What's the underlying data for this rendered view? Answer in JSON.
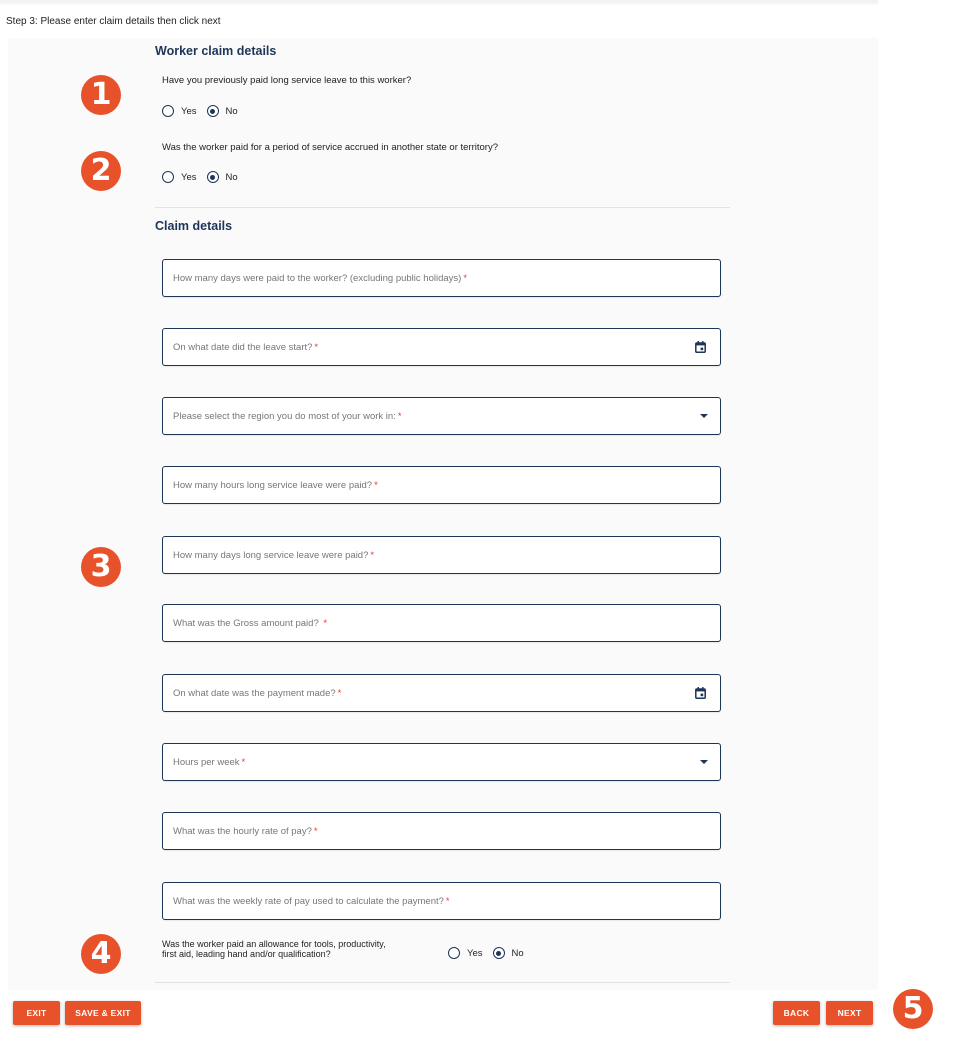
{
  "step_instruction": "Step 3: Please enter claim details then click next",
  "worker_claim_details": {
    "title": "Worker claim details",
    "questions": [
      {
        "text": "Have you previously paid long service leave to this worker?",
        "options": [
          "Yes",
          "No"
        ],
        "selected": "No"
      },
      {
        "text": "Was the worker paid for a period of service accrued in another state or territory?",
        "options": [
          "Yes",
          "No"
        ],
        "selected": "No"
      }
    ]
  },
  "claim_details": {
    "title": "Claim details",
    "required_marker": "*",
    "fields": [
      {
        "label": "How many days were paid to the worker? (excluding public holidays)",
        "value": "",
        "type": "text"
      },
      {
        "label": "On what date did the leave start?",
        "value": "",
        "type": "date",
        "icon": "calendar-icon"
      },
      {
        "label": "Please select the region you do most of your work in:",
        "value": "",
        "type": "select",
        "icon": "dropdown-caret-icon"
      },
      {
        "label": "How many hours long service leave were paid?",
        "value": "",
        "type": "text"
      },
      {
        "label": "How many days long service leave were paid?",
        "value": "",
        "type": "text"
      },
      {
        "label": "What was the Gross amount paid? ",
        "value": "",
        "type": "text"
      },
      {
        "label": "On what date was the payment made?",
        "value": "",
        "type": "date",
        "icon": "calendar-icon"
      },
      {
        "label": "Hours per week",
        "value": "",
        "type": "select",
        "icon": "dropdown-caret-icon"
      },
      {
        "label": "What was the hourly rate of pay?",
        "value": "",
        "type": "text"
      },
      {
        "label": "What was the weekly rate of pay used to calculate the payment?",
        "value": "",
        "type": "text"
      }
    ],
    "allowance_question": {
      "text_line1": "Was the worker paid an allowance for tools, productivity,",
      "text_line2": "first aid, leading hand and/or qualification?",
      "options": [
        "Yes",
        "No"
      ],
      "selected": "No"
    }
  },
  "buttons": {
    "exit": "EXIT",
    "save_exit": "SAVE & EXIT",
    "back": "BACK",
    "next": "NEXT"
  },
  "annotations": [
    "1",
    "2",
    "3",
    "4",
    "5"
  ],
  "colors": {
    "accent": "#e8522a",
    "primary": "#1d3557",
    "required": "#e53935",
    "panel_bg": "#fafafa"
  }
}
